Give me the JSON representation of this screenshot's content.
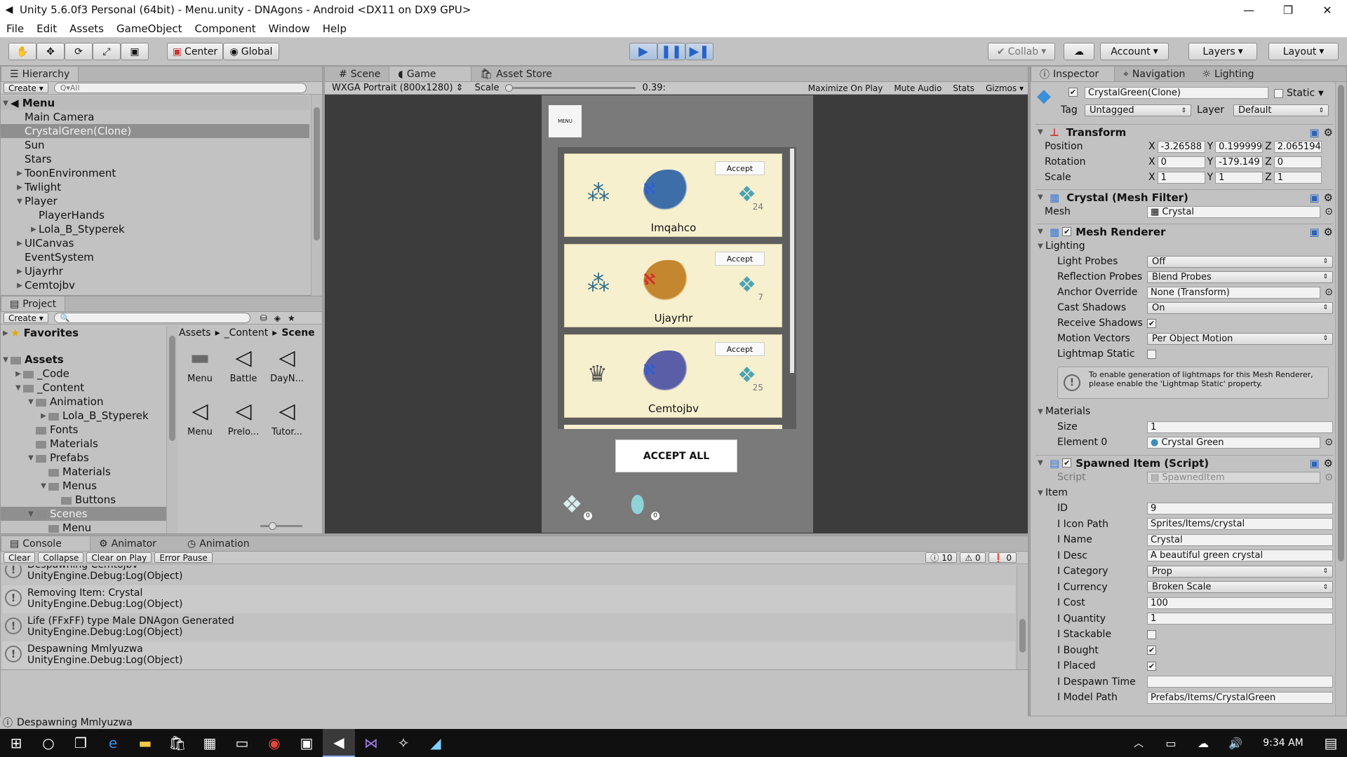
{
  "window": {
    "title": "Unity 5.6.0f3 Personal (64bit) - Menu.unity - DNAgons - Android <DX11 on DX9 GPU>",
    "min": "—",
    "max": "❐",
    "close": "✕"
  },
  "menu": [
    "File",
    "Edit",
    "Assets",
    "GameObject",
    "Component",
    "Window",
    "Help"
  ],
  "toolbar": {
    "center": "Center",
    "global": "Global",
    "collab": "Collab",
    "account": "Account",
    "layers": "Layers",
    "layout": "Layout"
  },
  "hierarchy": {
    "tab": "Hierarchy",
    "create": "Create",
    "search_placeholder": "Q▾All",
    "scene": "Menu",
    "items": [
      {
        "label": "Main Camera",
        "indent": 1,
        "arrow": ""
      },
      {
        "label": "CrystalGreen(Clone)",
        "indent": 1,
        "arrow": "",
        "selected": true
      },
      {
        "label": "Sun",
        "indent": 1,
        "arrow": ""
      },
      {
        "label": "Stars",
        "indent": 1,
        "arrow": ""
      },
      {
        "label": "ToonEnvironment",
        "indent": 1,
        "arrow": "▶"
      },
      {
        "label": "Twlight",
        "indent": 1,
        "arrow": "▶"
      },
      {
        "label": "Player",
        "indent": 1,
        "arrow": "▼"
      },
      {
        "label": "PlayerHands",
        "indent": 2,
        "arrow": ""
      },
      {
        "label": "Lola_B_Styperek",
        "indent": 2,
        "arrow": "▶"
      },
      {
        "label": "UICanvas",
        "indent": 1,
        "arrow": "▶"
      },
      {
        "label": "EventSystem",
        "indent": 1,
        "arrow": ""
      },
      {
        "label": "Ujayrhr",
        "indent": 1,
        "arrow": "▶"
      },
      {
        "label": "Cemtojbv",
        "indent": 1,
        "arrow": "▶"
      }
    ]
  },
  "project": {
    "tab": "Project",
    "create": "Create",
    "favorites": "Favorites",
    "tree": [
      {
        "label": "Assets",
        "indent": 0,
        "arrow": "▼",
        "bold": true
      },
      {
        "label": "_Code",
        "indent": 1,
        "arrow": "▶"
      },
      {
        "label": "_Content",
        "indent": 1,
        "arrow": "▼"
      },
      {
        "label": "Animation",
        "indent": 2,
        "arrow": "▼"
      },
      {
        "label": "Lola_B_Styperek",
        "indent": 3,
        "arrow": "▶"
      },
      {
        "label": "Fonts",
        "indent": 2,
        "arrow": ""
      },
      {
        "label": "Materials",
        "indent": 2,
        "arrow": ""
      },
      {
        "label": "Prefabs",
        "indent": 2,
        "arrow": "▼"
      },
      {
        "label": "Materials",
        "indent": 3,
        "arrow": ""
      },
      {
        "label": "Menus",
        "indent": 3,
        "arrow": "▼"
      },
      {
        "label": "Buttons",
        "indent": 4,
        "arrow": ""
      },
      {
        "label": "Scenes",
        "indent": 2,
        "arrow": "▼",
        "selected": true
      },
      {
        "label": "Menu",
        "indent": 3,
        "arrow": ""
      }
    ],
    "breadcrumb": [
      "Assets",
      "_Content",
      "Scene"
    ],
    "assets": [
      "Menu",
      "Battle",
      "DayN...",
      "Menu",
      "Prelo...",
      "Tutor..."
    ]
  },
  "game": {
    "tabs": [
      "Scene",
      "Game",
      "Asset Store"
    ],
    "resolution": "WXGA Portrait (800x1280)",
    "scale_label": "Scale",
    "scale_value": "0.39:",
    "buttons": [
      "Maximize On Play",
      "Mute Audio",
      "Stats",
      "Gizmos"
    ],
    "menu_btn": "MENU",
    "accept_all": "ACCEPT ALL",
    "cards": [
      {
        "name": "Imqahco",
        "accept": "Accept",
        "count": "24",
        "dragon_color": "#3d6ea8"
      },
      {
        "name": "Ujayrhr",
        "accept": "Accept",
        "count": "7",
        "dragon_color": "#c4862e"
      },
      {
        "name": "Cemtojbv",
        "accept": "Accept",
        "count": "25",
        "dragon_color": "#5a5ea6"
      }
    ],
    "bottom_counts": [
      "0",
      "0"
    ]
  },
  "console": {
    "tabs": [
      "Console",
      "Animator",
      "Animation"
    ],
    "buttons": [
      "Clear",
      "Collapse",
      "Clear on Play",
      "Error Pause"
    ],
    "counts": {
      "info": "10",
      "warn": "0",
      "error": "0"
    },
    "logs": [
      {
        "l1": "Despawning Cemtojbv",
        "l2": "UnityEngine.Debug:Log(Object)"
      },
      {
        "l1": "Removing Item: Crystal",
        "l2": "UnityEngine.Debug:Log(Object)"
      },
      {
        "l1": "Life (FFxFF) type Male DNAgon Generated",
        "l2": "UnityEngine.Debug:Log(Object)"
      },
      {
        "l1": "Despawning Mmlyuzwa",
        "l2": "UnityEngine.Debug:Log(Object)"
      }
    ],
    "status": "Despawning Mmlyuzwa"
  },
  "inspector": {
    "tabs": [
      "Inspector",
      "Navigation",
      "Lighting"
    ],
    "object_name": "CrystalGreen(Clone)",
    "static": "Static",
    "tag_label": "Tag",
    "tag": "Untagged",
    "layer_label": "Layer",
    "layer": "Default",
    "transform": {
      "title": "Transform",
      "position": [
        "-3.26588",
        "0.199999",
        "2.065194"
      ],
      "rotation": [
        "0",
        "-179.149",
        "0"
      ],
      "scale": [
        "1",
        "1",
        "1"
      ],
      "labels": [
        "Position",
        "Rotation",
        "Scale"
      ]
    },
    "mesh_filter": {
      "title": "Crystal (Mesh Filter)",
      "mesh_label": "Mesh",
      "mesh": "Crystal"
    },
    "mesh_renderer": {
      "title": "Mesh Renderer",
      "lighting": "Lighting",
      "light_probes_label": "Light Probes",
      "light_probes": "Off",
      "reflection_label": "Reflection Probes",
      "reflection": "Blend Probes",
      "anchor_label": "Anchor Override",
      "anchor": "None (Transform)",
      "cast_label": "Cast Shadows",
      "cast": "On",
      "receive_label": "Receive Shadows",
      "motion_label": "Motion Vectors",
      "motion": "Per Object Motion",
      "lightmap_label": "Lightmap Static",
      "help": "To enable generation of lightmaps for this Mesh Renderer, please enable the 'Lightmap Static' property.",
      "materials": "Materials",
      "size_label": "Size",
      "size": "1",
      "element_label": "Element 0",
      "element": "Crystal Green"
    },
    "spawned": {
      "title": "Spawned Item (Script)",
      "script_label": "Script",
      "script": "SpawnedItem",
      "item": "Item",
      "rows": [
        {
          "label": "ID",
          "value": "9",
          "type": "field"
        },
        {
          "label": "I Icon Path",
          "value": "Sprites/Items/crystal",
          "type": "field"
        },
        {
          "label": "I Name",
          "value": "Crystal",
          "type": "field"
        },
        {
          "label": "I Desc",
          "value": "A beautiful green crystal",
          "type": "field"
        },
        {
          "label": "I Category",
          "value": "Prop",
          "type": "drop"
        },
        {
          "label": "I Currency",
          "value": "Broken Scale",
          "type": "drop"
        },
        {
          "label": "I Cost",
          "value": "100",
          "type": "field"
        },
        {
          "label": "I Quantity",
          "value": "1",
          "type": "field"
        },
        {
          "label": "I Stackable",
          "value": "",
          "type": "chk"
        },
        {
          "label": "I Bought",
          "value": "✔",
          "type": "chk"
        },
        {
          "label": "I Placed",
          "value": "✔",
          "type": "chk"
        },
        {
          "label": "I Despawn Time",
          "value": "",
          "type": "field"
        },
        {
          "label": "I Model Path",
          "value": "Prefabs/Items/CrystalGreen",
          "type": "field"
        }
      ]
    }
  },
  "taskbar": {
    "time": "9:34 AM"
  }
}
